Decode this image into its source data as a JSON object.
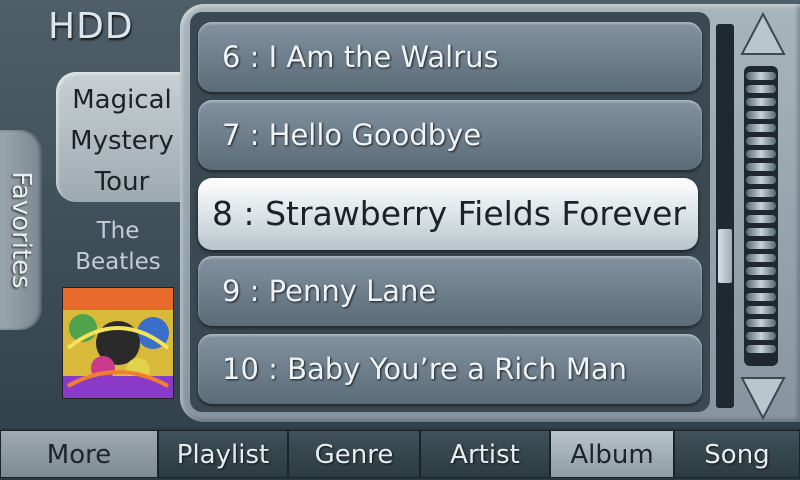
{
  "source": {
    "label": "HDD"
  },
  "sidebar": {
    "favorites_label": "Favorites"
  },
  "now_playing": {
    "album_title": "Magical Mystery Tour",
    "artist": "The Beatles",
    "album_art_icon": "album-cover"
  },
  "tracks": [
    {
      "number": "6",
      "title": "I Am the Walrus",
      "display": "6 :  I Am the Walrus"
    },
    {
      "number": "7",
      "title": "Hello Goodbye",
      "display": "7 :  Hello Goodbye"
    },
    {
      "number": "8",
      "title": "Strawberry Fields Forever",
      "display": "8 : Strawberry Fields Forever",
      "selected": true
    },
    {
      "number": "9",
      "title": "Penny Lane",
      "display": "9 :  Penny Lane"
    },
    {
      "number": "10",
      "title": "Baby You’re a Rich Man",
      "display": "10 :  Baby You’re a Rich Man"
    }
  ],
  "scroll": {
    "up_icon": "triangle-up-icon",
    "down_icon": "triangle-down-icon",
    "position_fraction": 0.62
  },
  "tabs": {
    "more": "More",
    "playlist": "Playlist",
    "genre": "Genre",
    "artist": "Artist",
    "album": "Album",
    "song": "Song",
    "active": "Album"
  },
  "colors": {
    "selected_row": "#ffffff",
    "row": "#6f808c",
    "panel": "#a8b5bc"
  }
}
